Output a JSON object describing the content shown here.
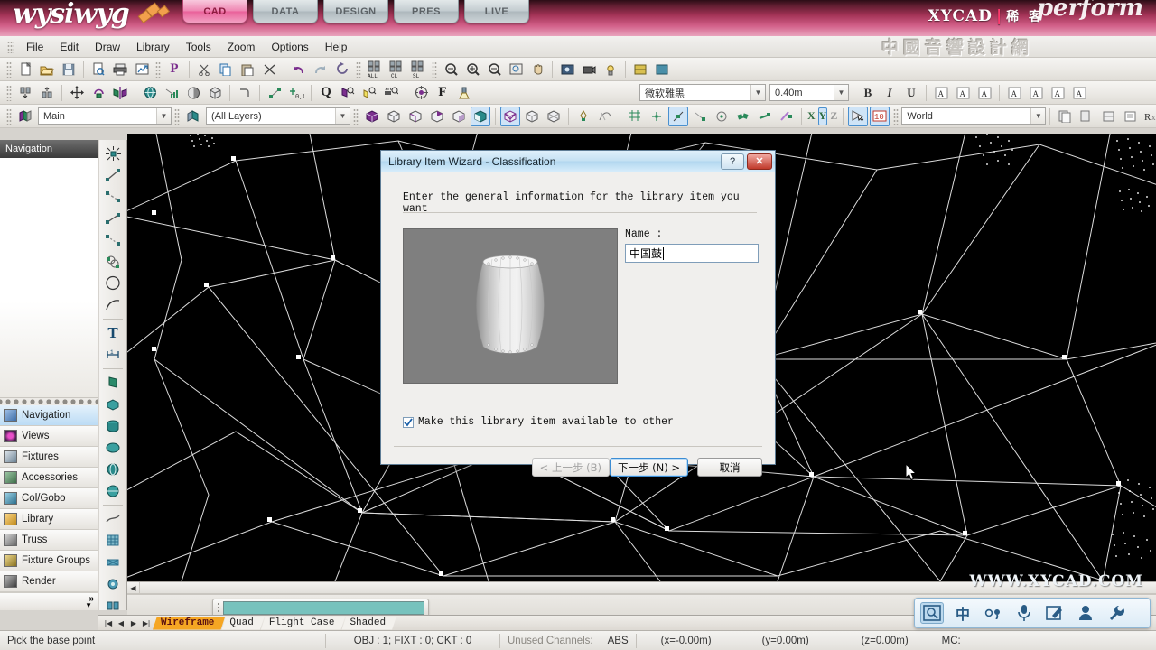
{
  "brand": {
    "logo": "wysiwyg",
    "product": "perform",
    "xycad": "XYCAD",
    "xycad_cn": "稀 客",
    "watermark_cn": "中國音響設計網",
    "watermark_url": "WWW.XYCAD.COM",
    "tabs": [
      {
        "label": "CAD",
        "active": true
      },
      {
        "label": "DATA",
        "active": false
      },
      {
        "label": "DESIGN",
        "active": false
      },
      {
        "label": "PRES",
        "active": false
      },
      {
        "label": "LIVE",
        "active": false
      }
    ]
  },
  "menu": {
    "items": [
      "File",
      "Edit",
      "Draw",
      "Library",
      "Tools",
      "Zoom",
      "Options",
      "Help"
    ]
  },
  "toolbar_text": {
    "all": "ALL",
    "cl": "CL",
    "sl": "SL",
    "p": "P",
    "f": "F",
    "q": "Q",
    "axis_x": "X",
    "axis_y": "Y",
    "axis_z": "Z"
  },
  "combos": {
    "font_family": "微软雅黑",
    "font_size": "0.40m",
    "layer_group": "Main",
    "layers": "(All Layers)",
    "coord_system": "World"
  },
  "text_style": {
    "bold": "B",
    "italic": "I",
    "underline": "U"
  },
  "left_panel": {
    "header": "Navigation",
    "items": [
      {
        "label": "Navigation",
        "icon": "navigation-icon",
        "selected": true,
        "color": "#5b7fb5"
      },
      {
        "label": "Views",
        "icon": "views-icon",
        "selected": false,
        "color": "#b53c9c"
      },
      {
        "label": "Fixtures",
        "icon": "fixtures-icon",
        "selected": false,
        "color": "#7a8f9e"
      },
      {
        "label": "Accessories",
        "icon": "accessories-icon",
        "selected": false,
        "color": "#6f8a6f"
      },
      {
        "label": "Col/Gobo",
        "icon": "colgobo-icon",
        "selected": false,
        "color": "#4f8fa8"
      },
      {
        "label": "Library",
        "icon": "library-icon",
        "selected": false,
        "color": "#d8a13a"
      },
      {
        "label": "Truss",
        "icon": "truss-icon",
        "selected": false,
        "color": "#8a8a8a"
      },
      {
        "label": "Fixture Groups",
        "icon": "fixture-groups-icon",
        "selected": false,
        "color": "#c4a23a"
      },
      {
        "label": "Render",
        "icon": "render-icon",
        "selected": false,
        "color": "#5a5a5a"
      }
    ],
    "more": "»"
  },
  "view_tabs": {
    "items": [
      {
        "label": "Wireframe",
        "active": true
      },
      {
        "label": "Quad",
        "active": false
      },
      {
        "label": "Flight Case",
        "active": false
      },
      {
        "label": "Shaded",
        "active": false
      }
    ]
  },
  "statusbar": {
    "hint": "Pick the base point",
    "counts": "OBJ : 1; FIXT : 0; CKT : 0",
    "unused_channels": "Unused Channels:",
    "abs": "ABS",
    "x": "(x=-0.00m)",
    "y": "(y=0.00m)",
    "z": "(z=0.00m)",
    "mc": "MC:"
  },
  "ime": {
    "items": [
      "ime-logo-icon",
      "chinese-mode-icon",
      "punctuation-icon",
      "microphone-icon",
      "handwriting-icon",
      "user-icon",
      "settings-wrench-icon"
    ],
    "mode_label": "中"
  },
  "dialog": {
    "title": "Library Item Wizard - Classification",
    "help_label": "?",
    "close_label": "✕",
    "intro": "Enter the general information for the library item you want",
    "name_label": "Name :",
    "name_value": "中国鼓",
    "checkbox_label": "Make this library item available to other",
    "checkbox_checked": true,
    "buttons": {
      "back": "< 上一步 (B)",
      "next": "下一步 (N) >",
      "cancel": "取消"
    },
    "preview_alt": "chinese-drum-3d-preview"
  },
  "colors": {
    "brand_pink": "#d3618a",
    "accent_blue": "#4a90cf",
    "tab_active_orange": "#f5a623",
    "progress_teal": "#77c2bd",
    "viewport_bg": "#000000"
  }
}
